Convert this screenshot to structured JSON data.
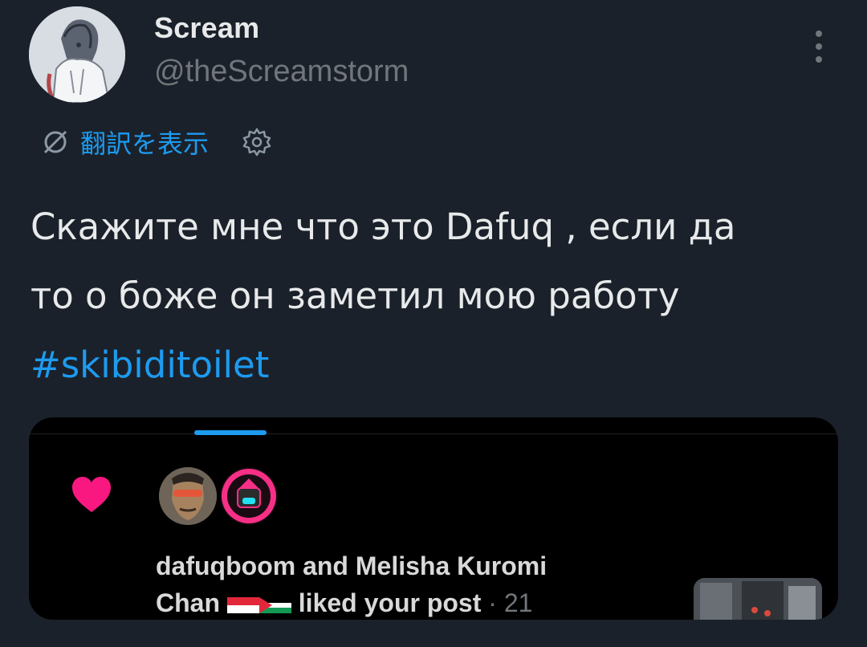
{
  "author": {
    "display_name": "Scream",
    "handle": "@theScreamstorm"
  },
  "translate": {
    "label": "翻訳を表示"
  },
  "post": {
    "text_line_1": "Скажите мне что это Dafuq , если да",
    "text_line_2": "то о боже он заметил мою работу",
    "hashtag": "#skibiditoilet"
  },
  "embedded_notification": {
    "line_1": "dafuqboom and Melisha Kuromi",
    "line_2_name": "Chan",
    "line_2_action": "liked your post",
    "time": "· 21"
  },
  "colors": {
    "background": "#1b212a",
    "accent": "#1d9bf0",
    "heart": "#f91880"
  },
  "icons": [
    "more-vertical-icon",
    "translate-icon",
    "gear-icon",
    "heart-icon",
    "flag-indonesia-icon",
    "flag-palestine-icon"
  ]
}
